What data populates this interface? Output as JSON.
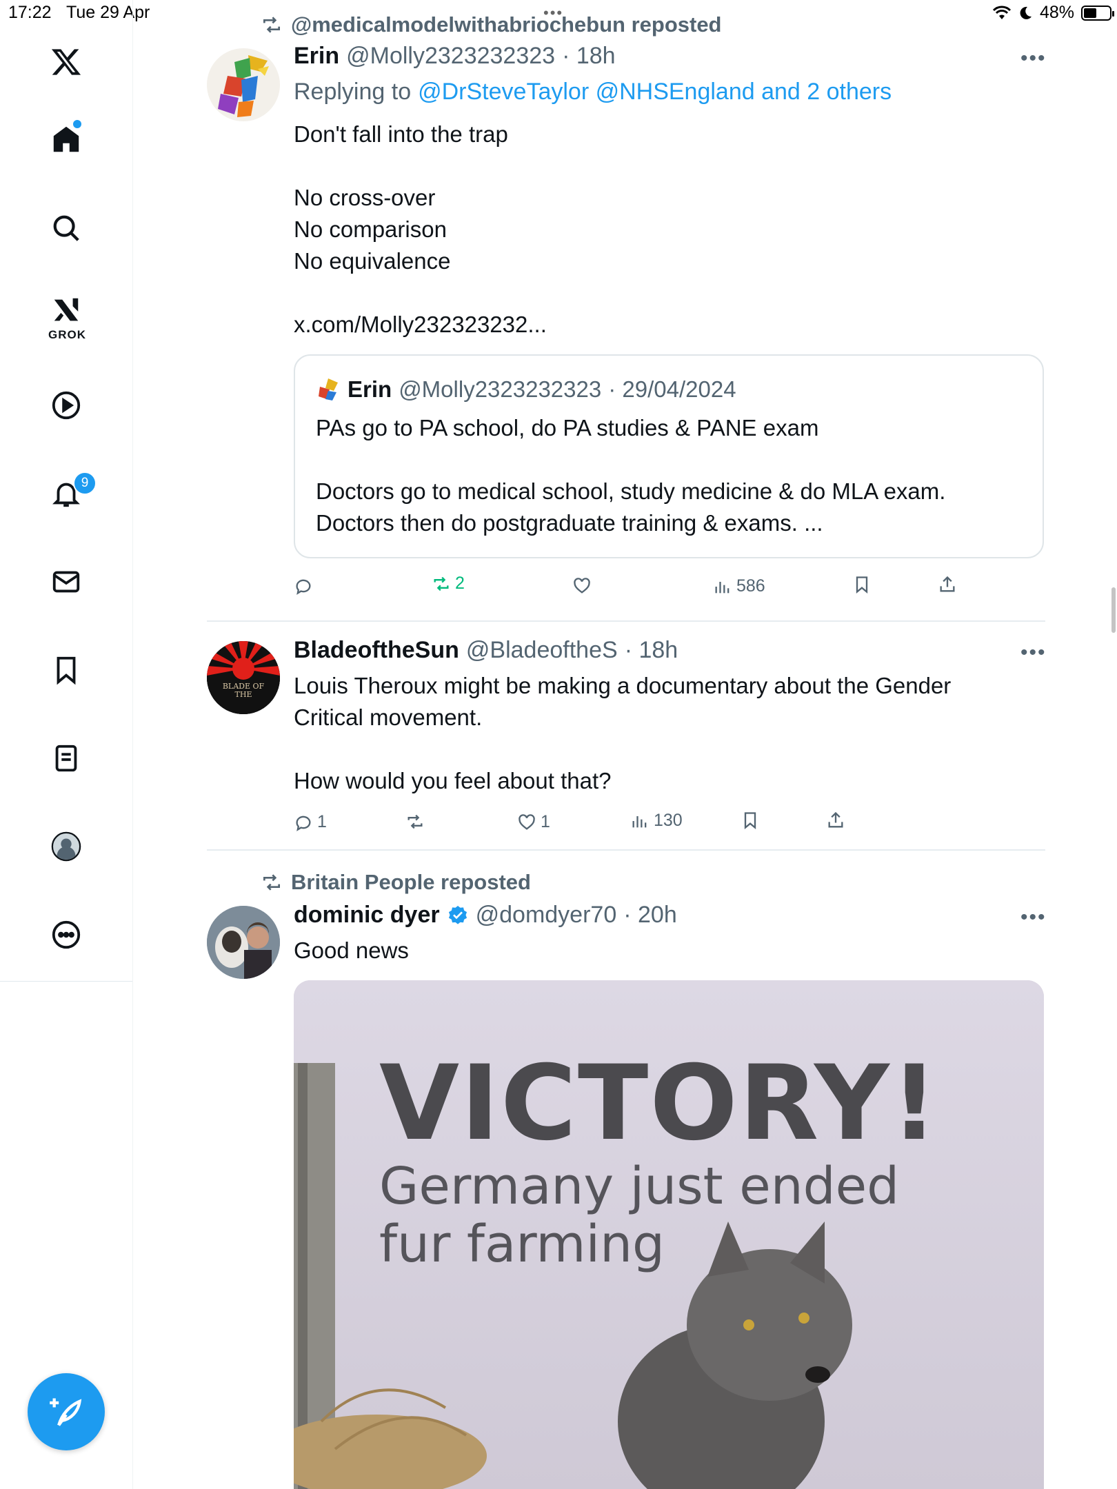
{
  "status_bar": {
    "time": "17:22",
    "date": "Tue 29 Apr",
    "battery": "48%"
  },
  "sidebar": {
    "items": [
      {
        "name": "x-logo"
      },
      {
        "name": "home"
      },
      {
        "name": "search"
      },
      {
        "name": "grok",
        "label": "GROK"
      },
      {
        "name": "videos"
      },
      {
        "name": "notifications",
        "badge": "9"
      },
      {
        "name": "messages"
      },
      {
        "name": "bookmarks"
      },
      {
        "name": "lists"
      },
      {
        "name": "profile"
      },
      {
        "name": "more"
      }
    ]
  },
  "posts": [
    {
      "repost_label": "@medicalmodelwithabriochebun reposted",
      "name": "Erin",
      "handle": "@Molly2323232323",
      "time": "· 18h",
      "replying_prefix": "Replying to",
      "replying_to": "@DrSteveTaylor @NHSEngland and 2 others",
      "lines": [
        "Don't fall into the trap",
        "No cross-over",
        "No comparison",
        "No equivalence"
      ],
      "link": "x.com/Molly232323232...",
      "quote": {
        "name": "Erin",
        "handle": "@Molly2323232323",
        "date": "· 29/04/2024",
        "line1": "PAs go to PA school, do PA studies & PANE exam",
        "line2": "Doctors go to medical school, study medicine & do MLA exam.",
        "line3": "Doctors then do postgraduate training & exams. ..."
      },
      "actions": {
        "reposts": "2",
        "views": "586"
      }
    },
    {
      "name": "BladeoftheSun",
      "handle": "@BladeoftheS",
      "time": "· 18h",
      "line1": "Louis Theroux might be making a documentary about the Gender",
      "line2": "Critical movement.",
      "line3": "How would you feel about that?",
      "avatar_text": "BLADE OF THE",
      "actions": {
        "replies": "1",
        "likes": "1",
        "views": "130"
      }
    },
    {
      "repost_label": "Britain People reposted",
      "name": "dominic dyer",
      "handle": "@domdyer70",
      "time": "· 20h",
      "text": "Good news",
      "media": {
        "headline": "VICTORY!",
        "sub1": "Germany just ended",
        "sub2": "fur farming"
      }
    }
  ],
  "colors": {
    "accent": "#1d9bf0",
    "text": "#0f1419",
    "muted": "#536471",
    "repost_green": "#00ba7c"
  }
}
